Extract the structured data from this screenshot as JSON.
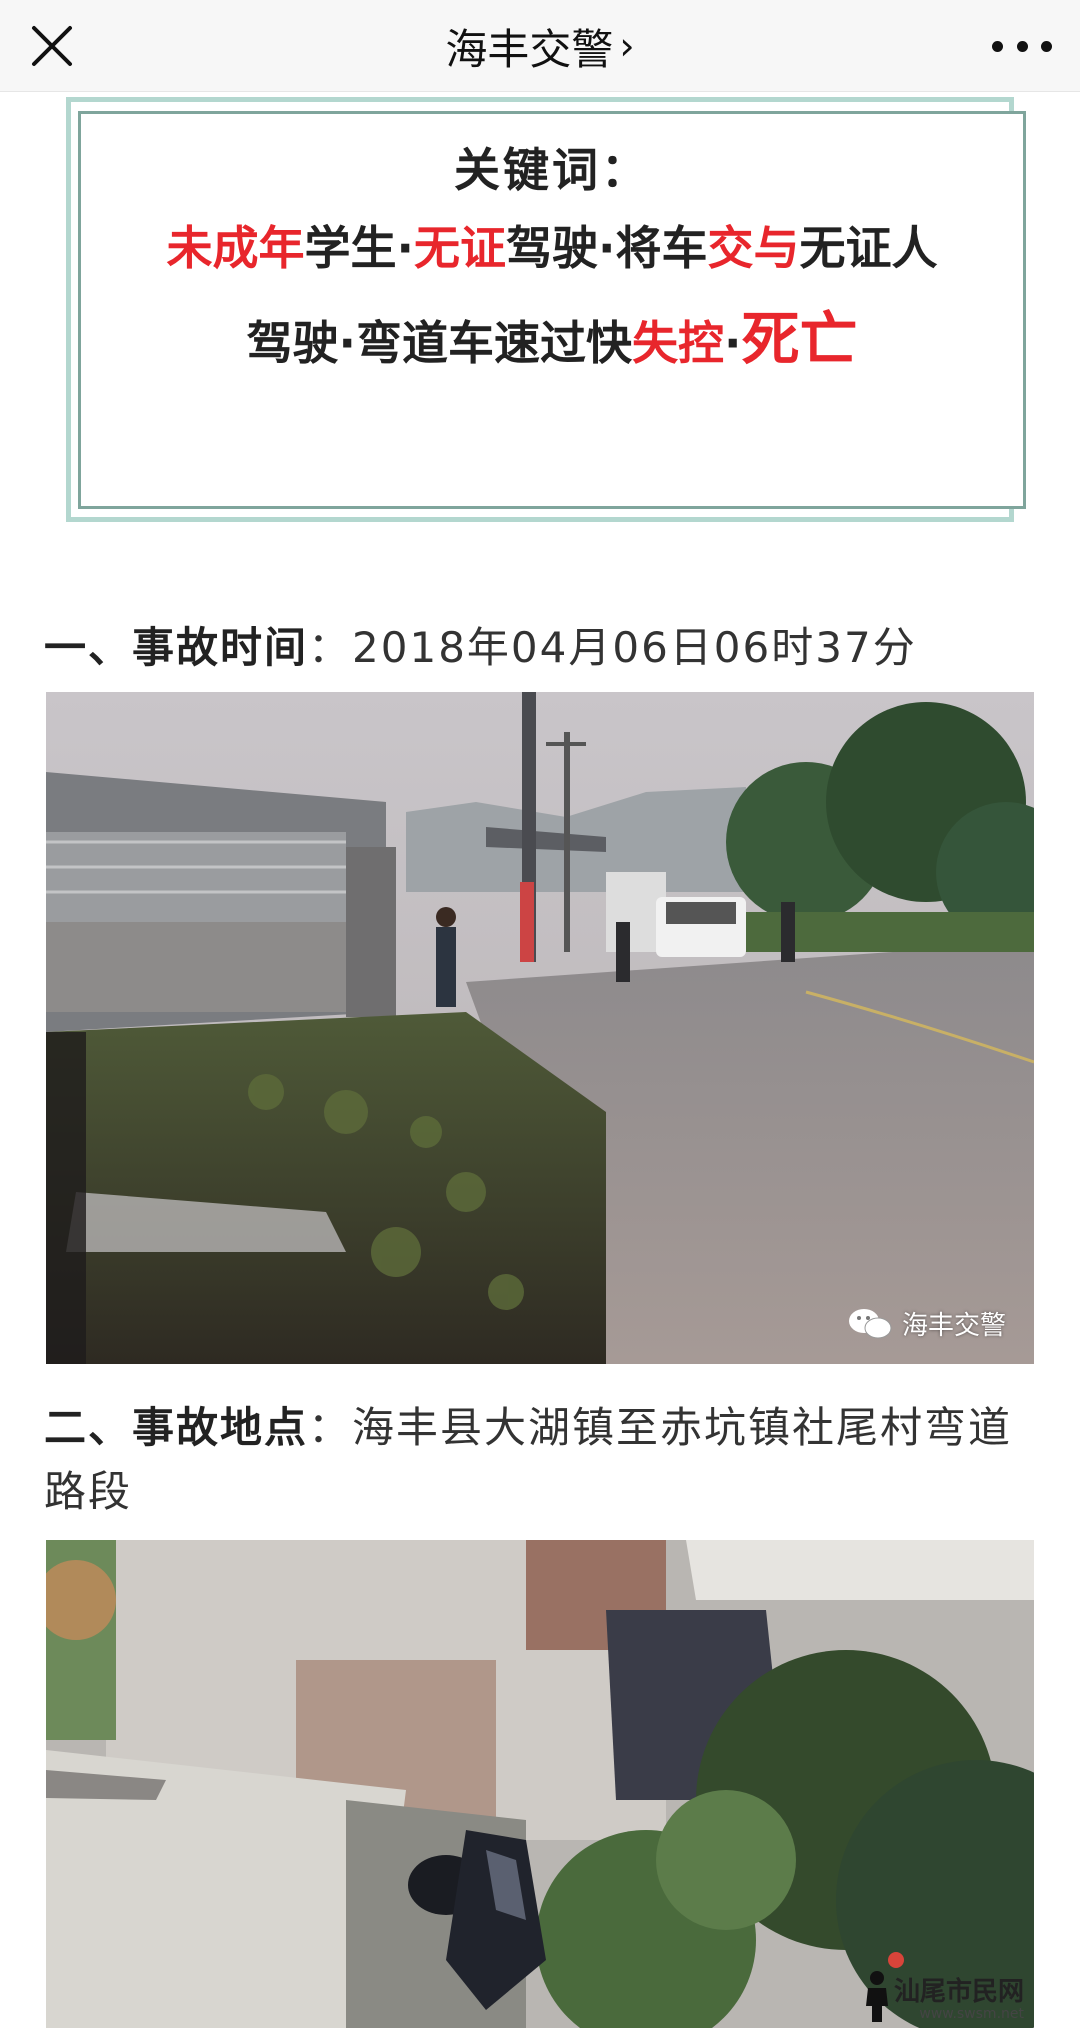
{
  "nav": {
    "title": "海丰交警",
    "chevron": "›",
    "close_icon": "close-icon",
    "more_icon": "more-dots-icon"
  },
  "keywords": {
    "title": "关键词：",
    "line1": [
      {
        "text": "未成年",
        "red": true
      },
      {
        "text": "学生·",
        "red": false
      },
      {
        "text": "无证",
        "red": true
      },
      {
        "text": "驾驶·将车",
        "red": false
      },
      {
        "text": "交与",
        "red": true
      },
      {
        "text": "无证人",
        "red": false
      }
    ],
    "line2": [
      {
        "text": "驾驶·弯道车速过快",
        "red": false
      },
      {
        "text": "失控",
        "red": true
      },
      {
        "text": "·",
        "red": false
      },
      {
        "text": "死亡",
        "red": true,
        "big": true
      }
    ]
  },
  "section1": {
    "label": "一、事故时间",
    "sep": "：",
    "value": "2018年04月06日06时37分"
  },
  "section2": {
    "label": "二、事故地点",
    "sep": "：",
    "value": "海丰县大湖镇至赤坑镇社尾村弯道路段"
  },
  "photo1": {
    "watermark": "海丰交警",
    "watermark_icon": "wechat-icon"
  },
  "footer_logo": {
    "text": "汕尾市民网",
    "url": "www.swsm.net"
  },
  "colors": {
    "accent_red": "#e8262c",
    "box_border": "#7fa59c",
    "box_shadow": "#b3d7cf"
  }
}
